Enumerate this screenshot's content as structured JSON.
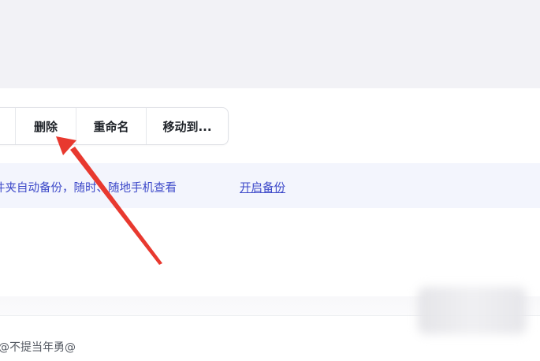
{
  "toolbar": {
    "delete_label": "删除",
    "rename_label": "重命名",
    "move_label": "移动到..."
  },
  "notice": {
    "text": "件夹自动备份，随时、随地手机查看",
    "link_label": "开启备份"
  },
  "footer": {
    "partial_text": "@不提当年勇@"
  },
  "colors": {
    "header_background": "#f2f2f6",
    "notice_background": "#f3f5fd",
    "link_color": "#3d49c9",
    "annotation_arrow": "#e8392f"
  }
}
